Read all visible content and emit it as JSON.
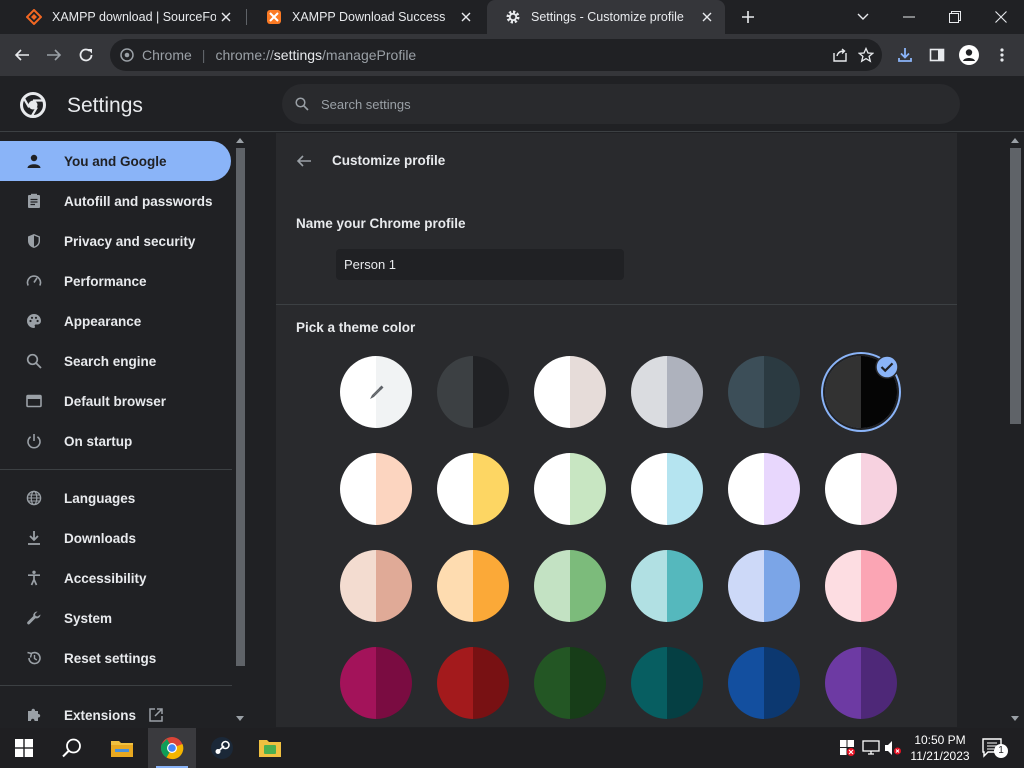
{
  "tabs": [
    {
      "title": "XAMPP download | SourceForge.",
      "active": false,
      "favicon": "sourceforge-icon"
    },
    {
      "title": "XAMPP Download Success",
      "active": false,
      "favicon": "xampp-icon"
    },
    {
      "title": "Settings - Customize profile",
      "active": true,
      "favicon": "gear-icon"
    }
  ],
  "omnibox": {
    "site": "Chrome",
    "scheme": "chrome://",
    "host": "settings",
    "path": "/manageProfile"
  },
  "header": {
    "title": "Settings",
    "search_placeholder": "Search settings"
  },
  "sidebar": {
    "items": [
      {
        "label": "You and Google",
        "icon": "person-icon",
        "selected": true
      },
      {
        "label": "Autofill and passwords",
        "icon": "clipboard-icon"
      },
      {
        "label": "Privacy and security",
        "icon": "shield-icon"
      },
      {
        "label": "Performance",
        "icon": "speedometer-icon"
      },
      {
        "label": "Appearance",
        "icon": "palette-icon"
      },
      {
        "label": "Search engine",
        "icon": "search-icon"
      },
      {
        "label": "Default browser",
        "icon": "browser-icon"
      },
      {
        "label": "On startup",
        "icon": "power-icon"
      },
      {
        "label": "Languages",
        "icon": "globe-icon"
      },
      {
        "label": "Downloads",
        "icon": "download-icon"
      },
      {
        "label": "Accessibility",
        "icon": "accessibility-icon"
      },
      {
        "label": "System",
        "icon": "wrench-icon"
      },
      {
        "label": "Reset settings",
        "icon": "reset-icon"
      },
      {
        "label": "Extensions",
        "icon": "puzzle-icon"
      }
    ]
  },
  "main": {
    "title": "Customize profile",
    "name_label": "Name your Chrome profile",
    "name_value": "Person 1",
    "theme_label": "Pick a theme color",
    "swatches": [
      {
        "left": "#ffffff",
        "right": "#f1f3f4",
        "kind": "custom"
      },
      {
        "left": "#3c4043",
        "right": "#202124"
      },
      {
        "left": "#ffffff",
        "right": "#e6dcd9"
      },
      {
        "left": "#dadce0",
        "right": "#aeb2bd"
      },
      {
        "left": "#3c4e58",
        "right": "#2b3a41"
      },
      {
        "left": "#323232",
        "right": "#050505",
        "selected": true
      },
      {
        "left": "#ffffff",
        "right": "#fcd5c0"
      },
      {
        "left": "#ffffff",
        "right": "#fdd663"
      },
      {
        "left": "#ffffff",
        "right": "#c8e6c2"
      },
      {
        "left": "#ffffff",
        "right": "#b5e4f0"
      },
      {
        "left": "#ffffff",
        "right": "#e8d7fd"
      },
      {
        "left": "#ffffff",
        "right": "#f7d2e0"
      },
      {
        "left": "#f3dcd0",
        "right": "#e0aa97"
      },
      {
        "left": "#fedcb0",
        "right": "#fba938"
      },
      {
        "left": "#c3e2c3",
        "right": "#7cbb7b"
      },
      {
        "left": "#b1e0e3",
        "right": "#55b8bd"
      },
      {
        "left": "#cdd9f8",
        "right": "#7ba5e7"
      },
      {
        "left": "#fddde2",
        "right": "#fba5b4"
      },
      {
        "left": "#a3135a",
        "right": "#7a0c41"
      },
      {
        "left": "#a31a1c",
        "right": "#781113"
      },
      {
        "left": "#235624",
        "right": "#173d18"
      },
      {
        "left": "#075e61",
        "right": "#053f43"
      },
      {
        "left": "#134f9f",
        "right": "#0c3870"
      },
      {
        "left": "#6d3aa3",
        "right": "#4e2878"
      }
    ]
  },
  "taskbar": {
    "time": "10:50 PM",
    "date": "11/21/2023",
    "notification_count": "1"
  },
  "colors": {
    "accent": "#8ab4f8",
    "bg": "#202124",
    "card": "#292a2d",
    "toolbar": "#35363a"
  }
}
